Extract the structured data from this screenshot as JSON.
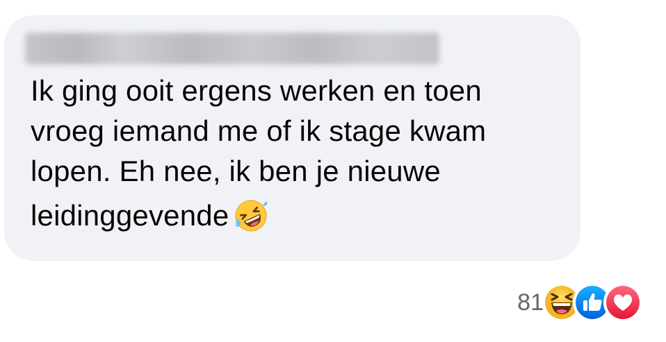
{
  "comment": {
    "author_name": "",
    "text_lines": [
      "Ik ging ooit ergens werken en toen",
      "vroeg iemand me of ik stage kwam",
      "lopen. Eh nee, ik ben je nieuwe",
      "leidinggevende"
    ],
    "inline_emoji": "rolling-on-the-floor-laughing"
  },
  "reactions": {
    "count": "81",
    "types": [
      "haha",
      "like",
      "love"
    ]
  },
  "colors": {
    "bubble": "#f0f2f5",
    "text": "#050505",
    "count": "#65676b",
    "like": "#1877f2",
    "love": "#f33e58",
    "haha": "#f7b125"
  }
}
